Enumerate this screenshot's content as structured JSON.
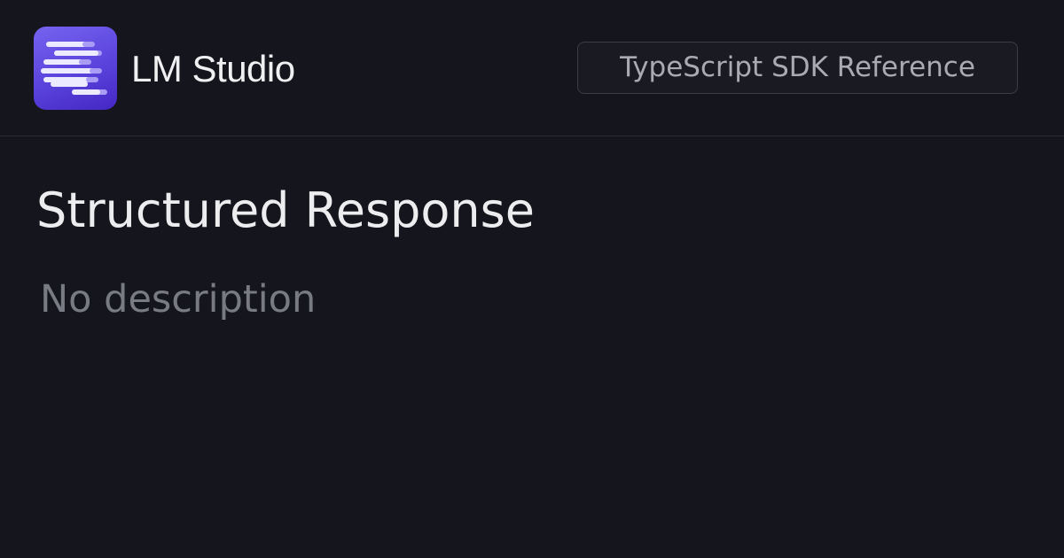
{
  "header": {
    "logo_icon": "lm-studio-logo-icon",
    "brand_name": "LM Studio",
    "section_badge": "TypeScript SDK Reference"
  },
  "main": {
    "title": "Structured Response",
    "description": "No description"
  },
  "colors": {
    "background": "#15161d",
    "logo_gradient_start": "#7663f0",
    "logo_gradient_end": "#4527c4",
    "title_text": "#ededf0",
    "muted_text": "#787a84"
  }
}
